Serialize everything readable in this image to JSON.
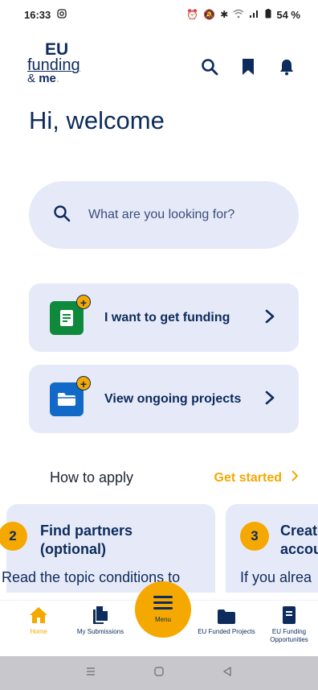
{
  "status_bar": {
    "time": "16:33",
    "battery": "54 %"
  },
  "header": {
    "logo_eu": "EU",
    "logo_funding": "funding",
    "logo_amp": "&",
    "logo_me": "me",
    "logo_dot": "."
  },
  "welcome": "Hi, welcome",
  "search": {
    "placeholder": "What are you looking for?"
  },
  "cards": [
    {
      "label": "I want to get funding",
      "icon": "document-plus-icon"
    },
    {
      "label": "View ongoing projects",
      "icon": "folder-plus-icon"
    }
  ],
  "how_to_apply": {
    "label": "How to apply",
    "get_started": "Get started",
    "steps": [
      {
        "number": "2",
        "title": "Find partners (optional)",
        "desc": "Read the topic conditions to"
      },
      {
        "number": "3",
        "title": "Creat",
        "title2": "accou",
        "desc": "If you alrea"
      }
    ]
  },
  "bottom_nav": {
    "items": [
      {
        "label": "Home",
        "icon": "home-icon"
      },
      {
        "label": "My Submissions",
        "icon": "documents-icon"
      },
      {
        "label": "Menu",
        "icon": "menu-icon"
      },
      {
        "label": "EU Funded Projects",
        "icon": "folder-icon"
      },
      {
        "label": "EU Funding Opportunities",
        "icon": "document-icon"
      }
    ]
  },
  "colors": {
    "navy": "#0d2b5c",
    "accent": "#f5a800",
    "card_bg": "#e6eaf8",
    "green": "#0f8a3c",
    "blue": "#1269c7"
  }
}
